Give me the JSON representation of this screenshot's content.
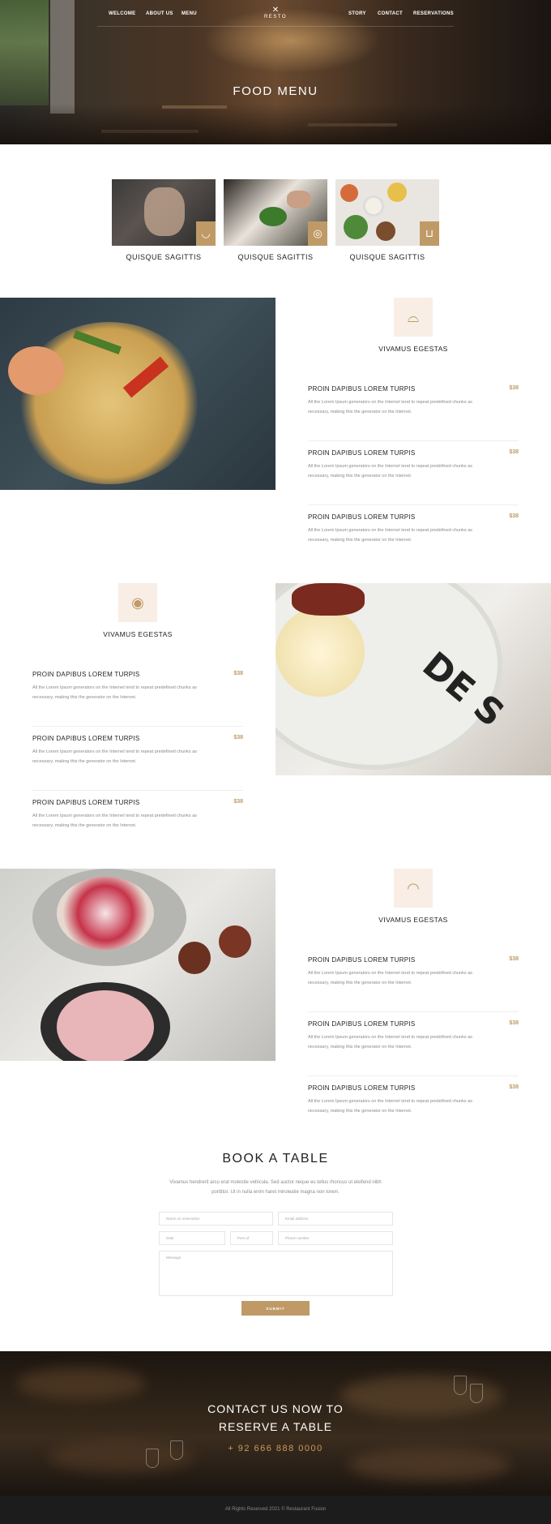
{
  "nav": {
    "left": [
      "WELCOME",
      "ABOUT US",
      "MENU"
    ],
    "right": [
      "STORY",
      "CONTACT",
      "RESERVATIONS"
    ],
    "logo_icon": "crossed-utensils-icon",
    "logo_text": "RESTO"
  },
  "hero": {
    "title": "FOOD MENU"
  },
  "cards": [
    {
      "label": "QUISQUE SAGITTIS",
      "icon": "bowl-icon"
    },
    {
      "label": "QUISQUE SAGITTIS",
      "icon": "fried-egg-icon"
    },
    {
      "label": "QUISQUE SAGITTIS",
      "icon": "fries-icon"
    }
  ],
  "sections": [
    {
      "title": "VIVAMUS EGESTAS",
      "icon": "grill-icon",
      "items": [
        {
          "name": "PROIN DAPIBUS LOREM TURPIS",
          "price": "$38",
          "desc": "All the Lorem Ipsum generators on the Internet tend to repeat predefined chunks as necessary, making this the generator on the Internet."
        },
        {
          "name": "PROIN DAPIBUS LOREM TURPIS",
          "price": "$38",
          "desc": "All the Lorem Ipsum generators on the Internet tend to repeat predefined chunks as necessary, making this the generator on the Internet."
        },
        {
          "name": "PROIN DAPIBUS LOREM TURPIS",
          "price": "$38",
          "desc": "All the Lorem Ipsum generators on the Internet tend to repeat predefined chunks as necessary, making this the generator on the Internet."
        }
      ]
    },
    {
      "title": "VIVAMUS EGESTAS",
      "icon": "egg-icon",
      "items": [
        {
          "name": "PROIN DAPIBUS LOREM TURPIS",
          "price": "$38",
          "desc": "All the Lorem Ipsum generators on the Internet tend to repeat predefined chunks as necessary, making this the generator on the Internet."
        },
        {
          "name": "PROIN DAPIBUS LOREM TURPIS",
          "price": "$38",
          "desc": "All the Lorem Ipsum generators on the Internet tend to repeat predefined chunks as necessary, making this the generator on the Internet."
        },
        {
          "name": "PROIN DAPIBUS LOREM TURPIS",
          "price": "$38",
          "desc": "All the Lorem Ipsum generators on the Internet tend to repeat predefined chunks as necessary, making this the generator on the Internet."
        }
      ]
    },
    {
      "title": "VIVAMUS EGESTAS",
      "icon": "croissant-icon",
      "items": [
        {
          "name": "PROIN DAPIBUS LOREM TURPIS",
          "price": "$38",
          "desc": "All the Lorem Ipsum generators on the Internet tend to repeat predefined chunks as necessary, making this the generator on the Internet."
        },
        {
          "name": "PROIN DAPIBUS LOREM TURPIS",
          "price": "$38",
          "desc": "All the Lorem Ipsum generators on the Internet tend to repeat predefined chunks as necessary, making this the generator on the Internet."
        },
        {
          "name": "PROIN DAPIBUS LOREM TURPIS",
          "price": "$38",
          "desc": "All the Lorem Ipsum generators on the Internet tend to repeat predefined chunks as necessary, making this the generator on the Internet."
        }
      ]
    }
  ],
  "booking": {
    "title": "BOOK A TABLE",
    "text": "Vivamus hendrerit arcu erat molestie vehicula. Sed auctor neque eu tellus rhoncus ut eleifend nibh porttitor. Ut in nulla enim haret miroleatie magna non lorem.",
    "placeholders": {
      "name": "Name on reservation",
      "email": "Email address",
      "date": "Date",
      "persons": "Pers of",
      "phone": "Phone number",
      "message": "Message"
    },
    "submit": "SUBMIT"
  },
  "contact": {
    "line1": "CONTACT US NOW TO",
    "line2": "RESERVE A TABLE",
    "phone": "+ 92 666 888 0000"
  },
  "footer": {
    "text": "All Rights Reserved 2021 © Restaurant Fusion"
  },
  "colors": {
    "accent": "#bf9a67",
    "icon_bg": "#f8eee6",
    "footer_bg": "#1c1c1c"
  }
}
